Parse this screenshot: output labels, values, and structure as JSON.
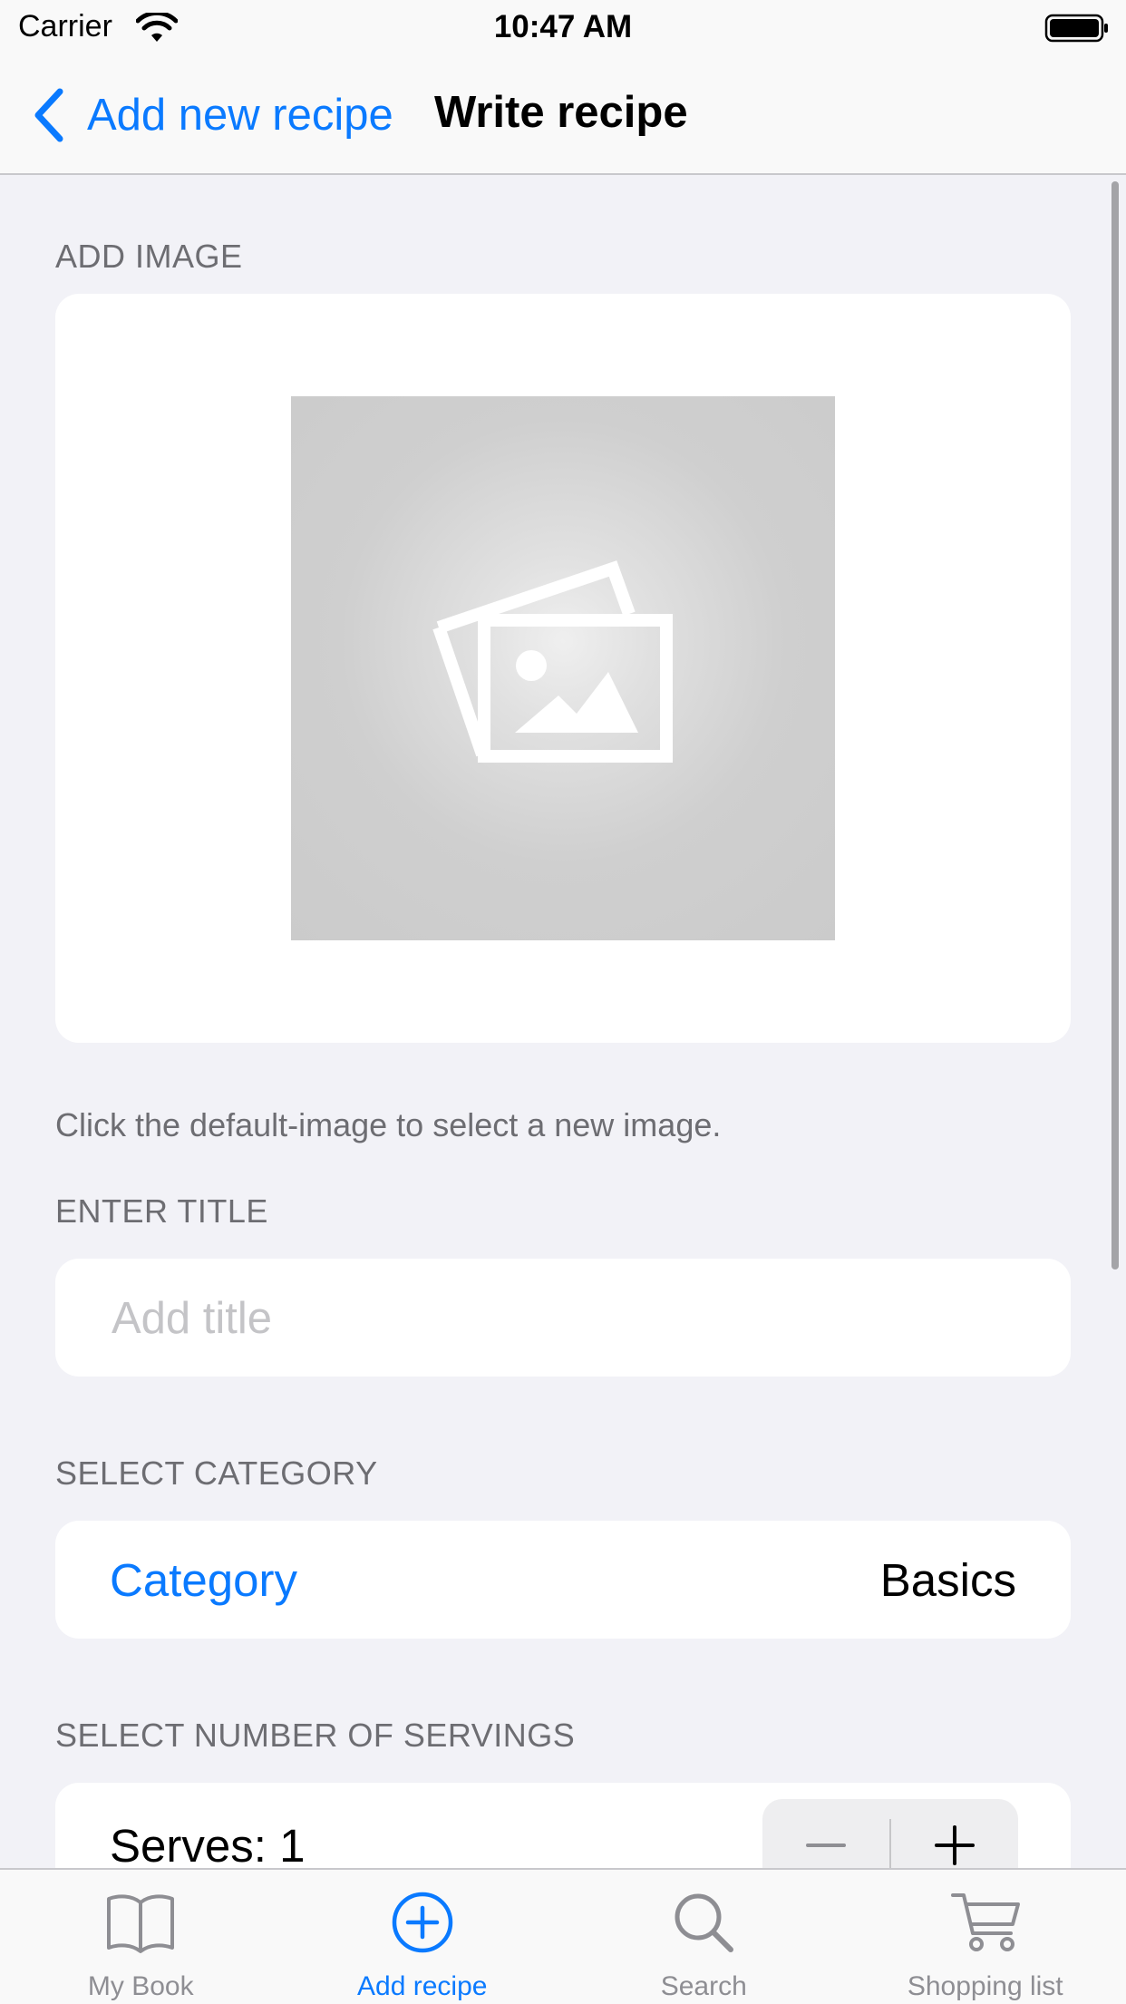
{
  "status_bar": {
    "carrier": "Carrier",
    "time": "10:47 AM"
  },
  "nav": {
    "back_label": "Add new recipe",
    "title": "Write recipe"
  },
  "sections": {
    "image_header": "ADD IMAGE",
    "image_caption": "Click the default-image to select a new image.",
    "title_header": "ENTER TITLE",
    "title_placeholder": "Add title",
    "title_value": "",
    "category_header": "SELECT CATEGORY",
    "category_label": "Category",
    "category_value": "Basics",
    "servings_header": "SELECT NUMBER OF SERVINGS",
    "serves_label": "Serves: 1"
  },
  "tabs": [
    {
      "label": "My Book",
      "icon": "book-icon",
      "active": false
    },
    {
      "label": "Add recipe",
      "icon": "plus-circle-icon",
      "active": true
    },
    {
      "label": "Search",
      "icon": "search-icon",
      "active": false
    },
    {
      "label": "Shopping list",
      "icon": "cart-icon",
      "active": false
    }
  ],
  "colors": {
    "accent": "#0a7aff",
    "background": "#f2f2f7",
    "secondary_text": "#6d6d72",
    "inactive_tab": "#8e8e93"
  }
}
